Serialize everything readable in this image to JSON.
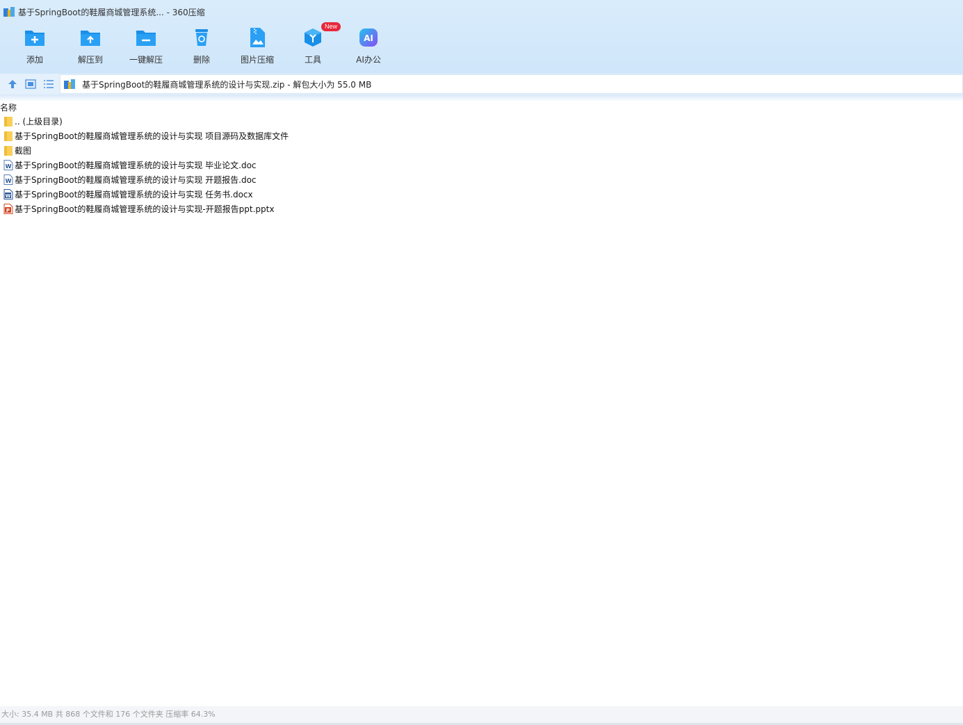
{
  "window": {
    "title": "基于SpringBoot的鞋履商城管理系统... - 360压缩"
  },
  "toolbar": [
    {
      "label": "添加",
      "icon": "add-folder-icon"
    },
    {
      "label": "解压到",
      "icon": "extract-to-icon"
    },
    {
      "label": "一键解压",
      "icon": "one-click-extract-icon"
    },
    {
      "label": "删除",
      "icon": "recycle-bin-icon"
    },
    {
      "label": "图片压缩",
      "icon": "image-compress-icon"
    },
    {
      "label": "工具",
      "icon": "tools-cube-icon",
      "badge": "New"
    },
    {
      "label": "AI办公",
      "icon": "ai-office-icon"
    }
  ],
  "address": {
    "path": "基于SpringBoot的鞋履商城管理系统的设计与实现.zip - 解包大小为 55.0 MB"
  },
  "list": {
    "column_name": "名称",
    "items": [
      {
        "name": ".. (上级目录)",
        "type": "folder"
      },
      {
        "name": "基于SpringBoot的鞋履商城管理系统的设计与实现  项目源码及数据库文件",
        "type": "folder"
      },
      {
        "name": "截图",
        "type": "folder"
      },
      {
        "name": "基于SpringBoot的鞋履商城管理系统的设计与实现  毕业论文.doc",
        "type": "doc"
      },
      {
        "name": "基于SpringBoot的鞋履商城管理系统的设计与实现 开题报告.doc",
        "type": "doc"
      },
      {
        "name": "基于SpringBoot的鞋履商城管理系统的设计与实现 任务书.docx",
        "type": "docx"
      },
      {
        "name": "基于SpringBoot的鞋履商城管理系统的设计与实现-开题报告ppt.pptx",
        "type": "pptx"
      }
    ]
  },
  "status": {
    "text": "大小: 35.4 MB 共 868 个文件和 176 个文件夹 压缩率 64.3%"
  },
  "colors": {
    "accent": "#1a8fe8",
    "folder": "#f5c542",
    "word": "#2b5797",
    "ppt": "#d24726"
  }
}
